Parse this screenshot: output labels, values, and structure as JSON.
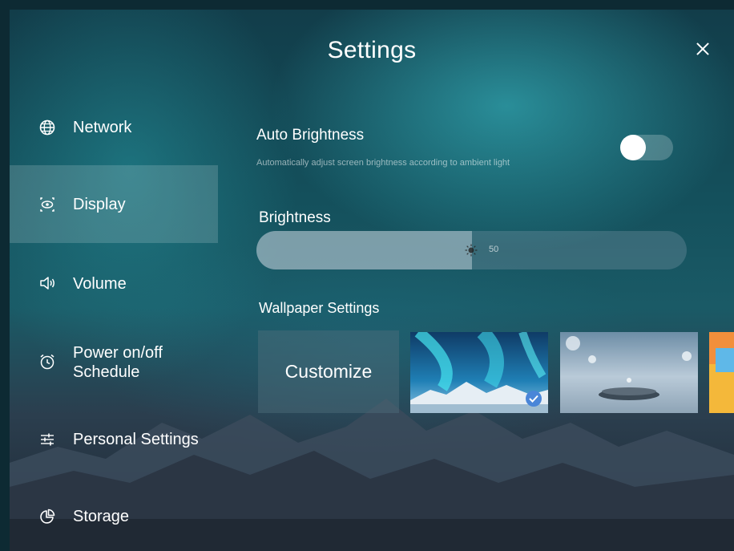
{
  "header": {
    "title": "Settings"
  },
  "sidebar": {
    "items": [
      {
        "label": "Network",
        "icon": "globe-icon"
      },
      {
        "label": "Display",
        "icon": "display-eye-icon",
        "active": true
      },
      {
        "label": "Volume",
        "icon": "speaker-icon"
      },
      {
        "label": "Power on/off Schedule",
        "icon": "alarm-clock-icon"
      },
      {
        "label": "Personal Settings",
        "icon": "sliders-icon"
      },
      {
        "label": "Storage",
        "icon": "pie-chart-icon"
      }
    ]
  },
  "display": {
    "auto_brightness": {
      "label": "Auto Brightness",
      "description": "Automatically adjust screen brightness according to ambient light",
      "enabled": false
    },
    "brightness": {
      "label": "Brightness",
      "value": "50",
      "fraction": 0.5
    },
    "wallpaper": {
      "label": "Wallpaper Settings",
      "customize_label": "Customize",
      "thumbnails": [
        {
          "name": "aurora-mountains",
          "selected": true
        },
        {
          "name": "water-droplets",
          "selected": false
        },
        {
          "name": "abstract-color",
          "selected": false
        }
      ]
    }
  },
  "colors": {
    "accent": "#4a86d8",
    "text": "#ffffff"
  }
}
